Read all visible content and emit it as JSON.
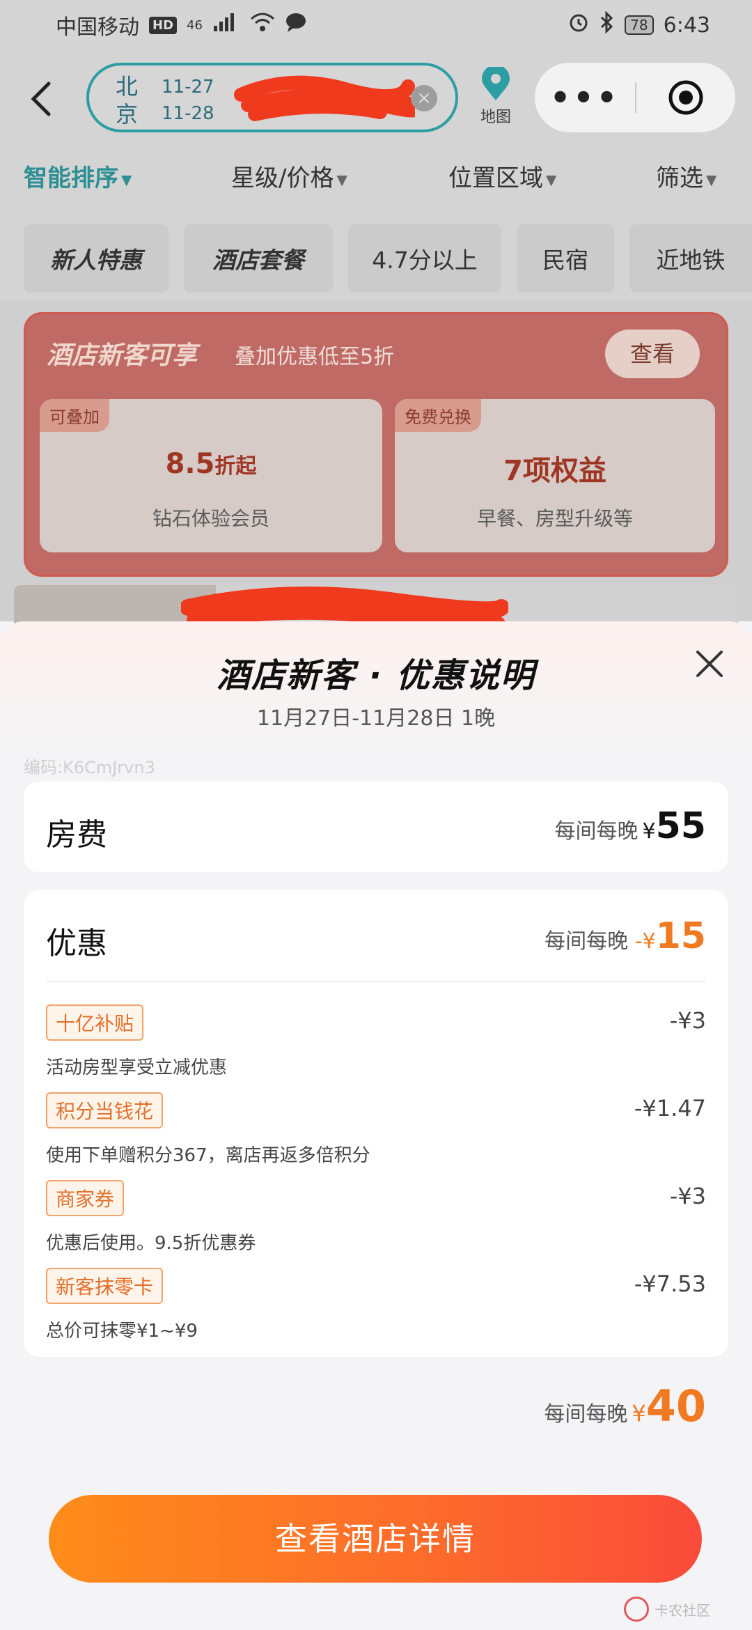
{
  "status_bar": {
    "carrier": "中国移动",
    "hd": "HD",
    "network": "46",
    "battery": "78",
    "time": "6:43"
  },
  "nav": {
    "city_lines": [
      "北",
      "京"
    ],
    "checkin": "11-27",
    "checkout": "11-28",
    "map_label": "地图",
    "more_label": "•••"
  },
  "sort_bar": {
    "smart": "智能排序",
    "star_price": "星级/价格",
    "location": "位置区域",
    "filter": "筛选"
  },
  "chips": [
    "新人特惠",
    "酒店套餐",
    "4.7分以上",
    "民宿",
    "近地铁"
  ],
  "promo": {
    "title": "酒店新客可享",
    "subtitle": "叠加优惠低至5折",
    "view_button": "查看",
    "benefit_left": {
      "tag": "可叠加",
      "value": "8.5",
      "suffix": "折起",
      "desc": "钻石体验会员"
    },
    "benefit_right": {
      "tag": "免费兑换",
      "value": "7项权益",
      "desc": "早餐、房型升级等"
    }
  },
  "sheet": {
    "title": "酒店新客 · 优惠说明",
    "date_range": "11月27日-11月28日 1晚",
    "code": "编码:K6CmJrvn3",
    "room_fee": {
      "label": "房费",
      "unit": "每间每晚",
      "currency": "¥",
      "amount": "55"
    },
    "discount": {
      "label": "优惠",
      "unit": "每间每晚",
      "minus": "-",
      "currency": "¥",
      "amount": "15",
      "items": [
        {
          "tag": "十亿补贴",
          "amount": "-¥3",
          "note": "活动房型享受立减优惠"
        },
        {
          "tag": "积分当钱花",
          "amount": "-¥1.47",
          "note": "使用下单赠积分367，离店再返多倍积分"
        },
        {
          "tag": "商家券",
          "amount": "-¥3",
          "note": "优惠后使用。9.5折优惠券"
        },
        {
          "tag": "新客抹零卡",
          "amount": "-¥7.53",
          "note": "总价可抹零¥1~¥9"
        }
      ]
    },
    "total": {
      "unit": "每间每晚",
      "currency": "¥",
      "amount": "40"
    },
    "cta": "查看酒店详情",
    "watermark": "卡农社区"
  },
  "colors": {
    "accent_orange": "#ef7a22",
    "teal": "#2b8f94",
    "cta_start": "#fe8c1a",
    "cta_end": "#fa4a3a"
  }
}
